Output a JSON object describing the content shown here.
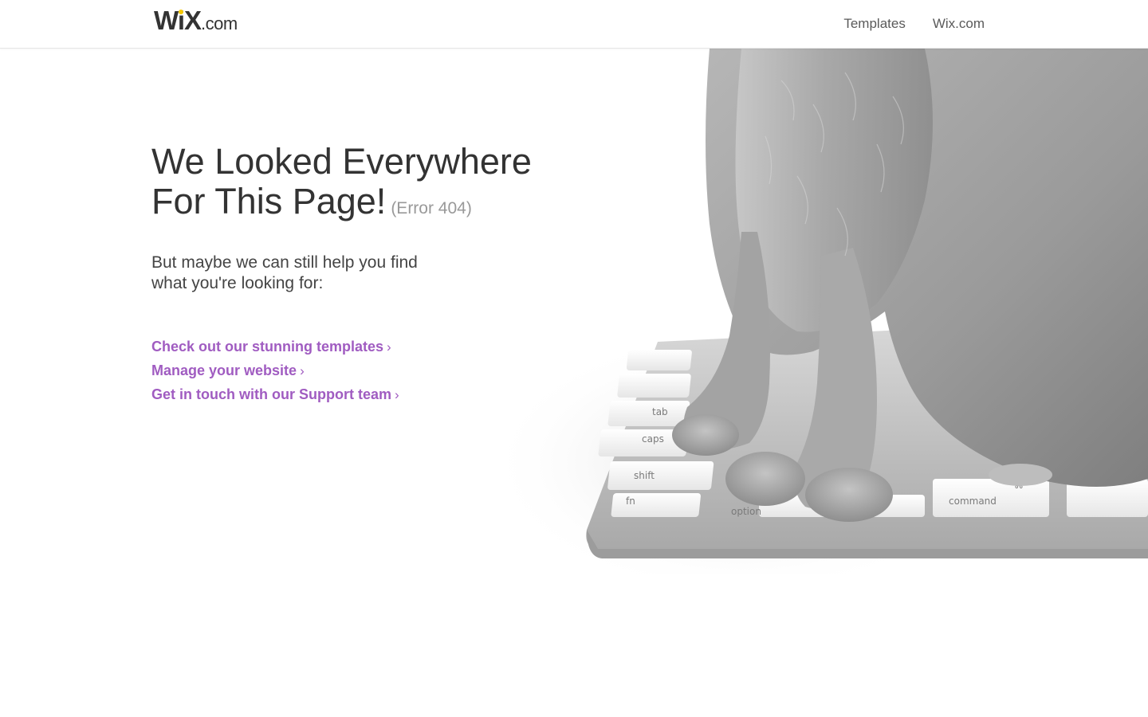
{
  "header": {
    "logo_main": "WiX",
    "logo_suffix": ".com",
    "nav": [
      {
        "label": "Templates"
      },
      {
        "label": "Wix.com"
      }
    ]
  },
  "main": {
    "headline_line1": "We Looked Everywhere",
    "headline_line2": "For This Page!",
    "error_code": "(Error 404)",
    "subtitle_line1": "But maybe we can still help you find",
    "subtitle_line2": "what you're looking for:",
    "links": [
      {
        "label": "Check out our stunning templates",
        "chevron": "›"
      },
      {
        "label": "Manage your website",
        "chevron": "›"
      },
      {
        "label": "Get in touch with our Support team",
        "chevron": "›"
      }
    ]
  },
  "colors": {
    "link": "#a05cc1",
    "logo_dot": "#f6c800",
    "text": "#333333",
    "muted": "#999999"
  },
  "illustration": {
    "subject": "gray cat sitting on a keyboard",
    "key_labels": [
      "tab",
      "caps",
      "shift",
      "fn",
      "option",
      "command",
      "⌘"
    ]
  }
}
